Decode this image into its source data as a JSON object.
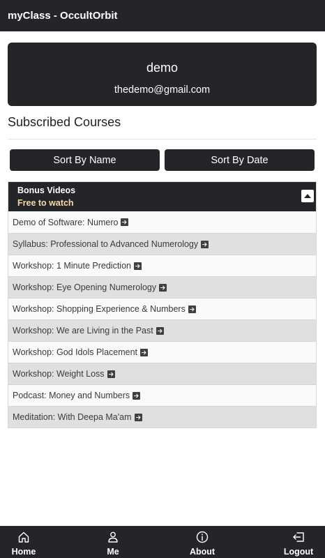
{
  "app": {
    "title": "myClass - OccultOrbit"
  },
  "profile": {
    "name": "demo",
    "email": "thedemo@gmail.com"
  },
  "section": {
    "title": "Subscribed Courses"
  },
  "sort": {
    "by_name_label": "Sort By Name",
    "by_date_label": "Sort By Date"
  },
  "group": {
    "title": "Bonus Videos",
    "subtitle": "Free to watch",
    "expanded": true,
    "courses": [
      {
        "label": "Demo of Software: Numero"
      },
      {
        "label": "Syllabus: Professional to Advanced Numerology"
      },
      {
        "label": "Workshop: 1 Minute Prediction"
      },
      {
        "label": "Workshop: Eye Opening Numerology"
      },
      {
        "label": "Workshop: Shopping Experience & Numbers"
      },
      {
        "label": "Workshop: We are Living in the Past"
      },
      {
        "label": "Workshop: God Idols Placement"
      },
      {
        "label": "Workshop: Weight Loss"
      },
      {
        "label": "Podcast: Money and Numbers"
      },
      {
        "label": "Meditation: With Deepa Ma'am"
      }
    ]
  },
  "nav": {
    "home": {
      "label": "Home",
      "icon": "home-icon"
    },
    "me": {
      "label": "Me",
      "icon": "person-icon"
    },
    "about": {
      "label": "About",
      "icon": "info-icon"
    },
    "logout": {
      "label": "Logout",
      "icon": "logout-icon"
    }
  },
  "colors": {
    "dark": "#232528",
    "subtitle_accent": "#f6d9a8",
    "row_alt": "#e0e0e0"
  }
}
